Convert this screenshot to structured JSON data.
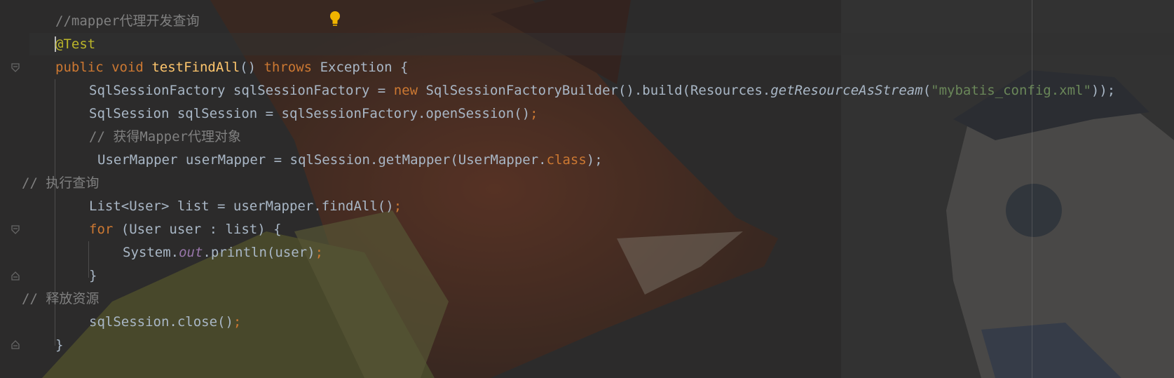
{
  "editor": {
    "background_image": "zootopia-nick-judy-wallpaper",
    "colors": {
      "keyword": "#cc7832",
      "annotation": "#bbb529",
      "method": "#ffc66d",
      "string": "#6a8759",
      "comment": "#808080",
      "field": "#9876aa",
      "text": "#a9b7c6"
    }
  },
  "code": {
    "l1": {
      "comment": "//mapper代理开发查询"
    },
    "l2": {
      "annotation": "@Test"
    },
    "l3": {
      "public": "public",
      "void": "void",
      "name": "testFindAll",
      "parens": "() ",
      "throws": "throws",
      "rest": " Exception {"
    },
    "l4": {
      "a": "SqlSessionFactory sqlSessionFactory = ",
      "new": "new",
      "b": " SqlSessionFactoryBuilder().build(Resources.",
      "m": "getResourceAsStream",
      "c": "(",
      "s": "\"mybatis_config.xml\"",
      "d": "));"
    },
    "l5": {
      "a": "SqlSession sqlSession = sqlSessionFactory.openSession()",
      "semi": ";"
    },
    "l6": {
      "comment": "// 获得Mapper代理对象"
    },
    "l7": {
      "a": "UserMapper userMapper = sqlSession.getMapper(UserMapper.",
      "cls": "class",
      "b": ");"
    },
    "l8": {
      "comment": "// 执行查询"
    },
    "l9": {
      "a": "List<User> list = userMapper.findAll()",
      "semi": ";"
    },
    "l10": {
      "for": "for",
      "a": " (User user : list) {"
    },
    "l11": {
      "a": "System.",
      "out": "out",
      "b": ".println(user)",
      "semi": ";"
    },
    "l12": {
      "a": "}"
    },
    "l13": {
      "comment": "// 释放资源"
    },
    "l14": {
      "a": "sqlSession.close()",
      "semi": ";"
    },
    "l15": {
      "a": "}"
    }
  }
}
